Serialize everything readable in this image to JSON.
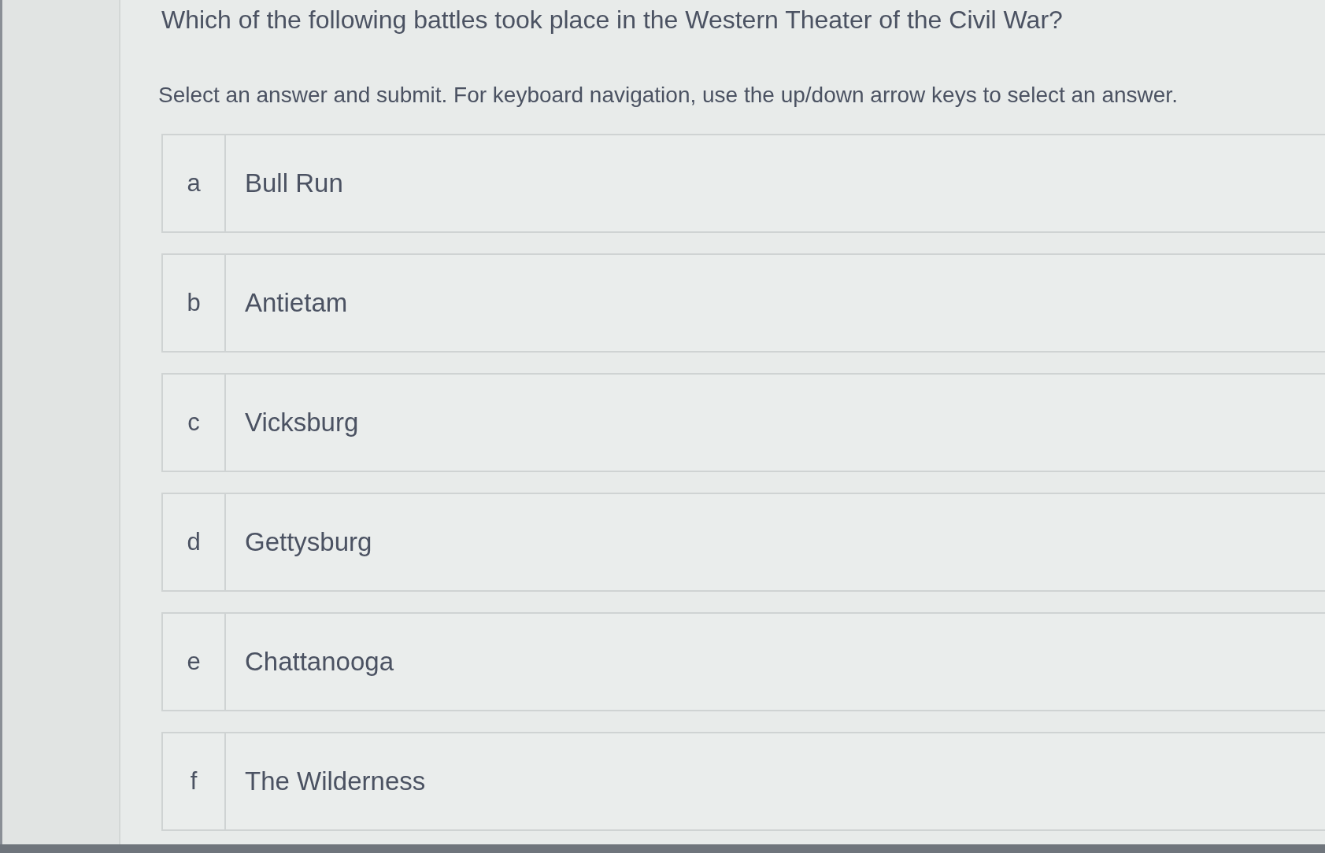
{
  "question": "Which of the following battles took place in the Western Theater of the Civil War?",
  "instructions": "Select an answer and submit. For keyboard navigation, use the up/down arrow keys to select an answer.",
  "options": [
    {
      "letter": "a",
      "label": "Bull Run",
      "selected": false
    },
    {
      "letter": "b",
      "label": "Antietam",
      "selected": false
    },
    {
      "letter": "c",
      "label": "Vicksburg",
      "selected": false
    },
    {
      "letter": "d",
      "label": "Gettysburg",
      "selected": false
    },
    {
      "letter": "e",
      "label": "Chattanooga",
      "selected": false
    },
    {
      "letter": "f",
      "label": "The Wilderness",
      "selected": false
    }
  ]
}
